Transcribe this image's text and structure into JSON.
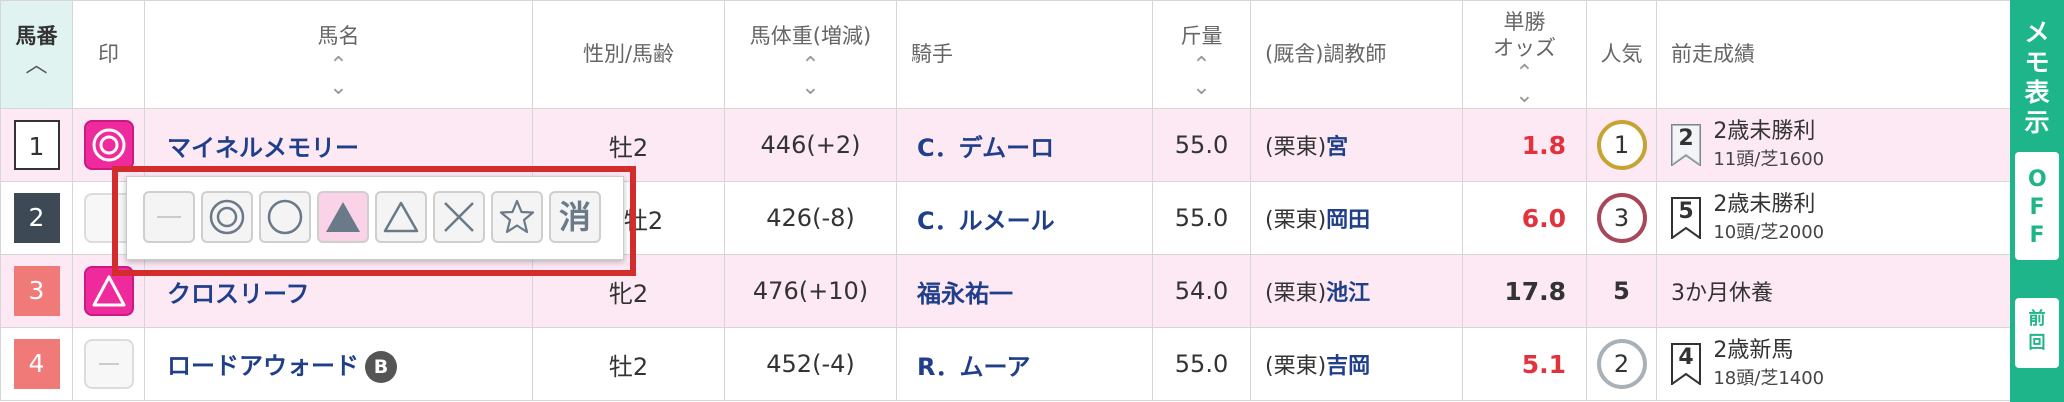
{
  "header": {
    "umaban": "馬番",
    "mark": "印",
    "horse_name": "馬名",
    "sex_age": "性別/馬齢",
    "weight": "馬体重(増減)",
    "jockey": "騎手",
    "kinryo": "斤量",
    "trainer": "(厩舎)調教師",
    "odds_line1": "単勝",
    "odds_line2": "オッズ",
    "popularity": "人気",
    "prev_result": "前走成績",
    "sort_up": "^",
    "sort_updown": "⌃⌄"
  },
  "rows": [
    {
      "umaban": "1",
      "mark": "double-circle",
      "name": "マイネルメモリー",
      "blinker": "",
      "sex_age": "牡2",
      "weight": "446(+2)",
      "jockey": "C．デムーロ",
      "kinryo": "55.0",
      "trainer_region": "(栗東)",
      "trainer_name": "宮",
      "odds": "1.8",
      "odds_color": "red",
      "popularity": "1",
      "pop_color": "gold",
      "prev_rank": "2",
      "prev_race": "2歳未勝利",
      "prev_detail": "11頭/芝1600"
    },
    {
      "umaban": "2",
      "mark": "none",
      "name": "",
      "blinker": "",
      "sex_age": "牡2",
      "weight": "426(-8)",
      "jockey": "C．ルメール",
      "kinryo": "55.0",
      "trainer_region": "(栗東)",
      "trainer_name": "岡田",
      "odds": "6.0",
      "odds_color": "red",
      "popularity": "3",
      "pop_color": "red",
      "prev_rank": "5",
      "prev_race": "2歳未勝利",
      "prev_detail": "10頭/芝2000"
    },
    {
      "umaban": "3",
      "mark": "triangle",
      "name": "クロスリーフ",
      "blinker": "",
      "sex_age": "牝2",
      "weight": "476(+10)",
      "jockey": "福永祐一",
      "kinryo": "54.0",
      "trainer_region": "(栗東)",
      "trainer_name": "池江",
      "odds": "17.8",
      "odds_color": "dark",
      "popularity": "5",
      "pop_color": "none",
      "prev_rank": "",
      "prev_race": "3か月休養",
      "prev_detail": ""
    },
    {
      "umaban": "4",
      "mark": "none",
      "name": "ロードアウォード",
      "blinker": "B",
      "sex_age": "牡2",
      "weight": "452(-4)",
      "jockey": "R．ムーア",
      "kinryo": "55.0",
      "trainer_region": "(栗東)",
      "trainer_name": "吉岡",
      "odds": "5.1",
      "odds_color": "red",
      "popularity": "2",
      "pop_color": "silver",
      "prev_rank": "4",
      "prev_race": "2歳新馬",
      "prev_detail": "18頭/芝1400"
    }
  ],
  "row_styles": {
    "frame_colors": [
      "#ffffff",
      "#3d4a55",
      "#f07a78",
      "#f07a78"
    ],
    "frame_text_colors": [
      "#333333",
      "#ffffff",
      "#ffffff",
      "#ffffff"
    ],
    "frame_border": [
      "#333333",
      "#3d4a55",
      "#f07a78",
      "#f07a78"
    ]
  },
  "side_panel": {
    "memo": "メモ表示",
    "off": "OFF",
    "prev": "前回",
    "color": "#1fb58a"
  },
  "mark_popup": {
    "options": [
      "none",
      "double-circle",
      "circle",
      "filled-triangle",
      "triangle",
      "cross",
      "star",
      "消"
    ],
    "selected": "filled-triangle",
    "erase_label": "消"
  },
  "colors": {
    "accent_pink": "#ee2a9c",
    "odds_red": "#e0333e",
    "link_blue": "#1f3f8a",
    "highlight_frame": "#d32c2c"
  }
}
